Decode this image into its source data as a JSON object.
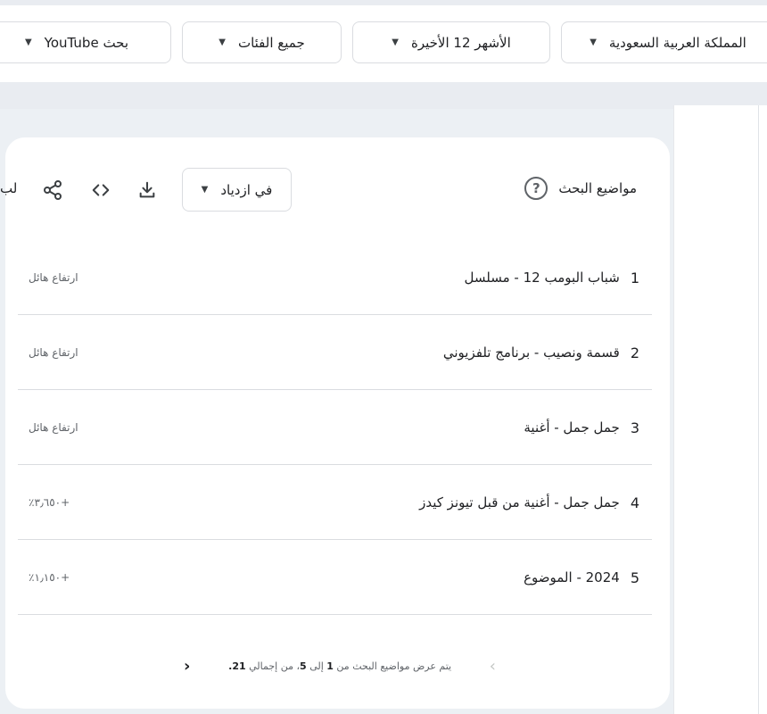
{
  "filters": {
    "region": "المملكة العربية السعودية",
    "period": "الأشهر 12 الأخيرة",
    "category": "جميع الفئات",
    "search_type": "بحث YouTube"
  },
  "card": {
    "title": "مواضيع البحث",
    "help_glyph": "?",
    "trend_select": "في ازدياد",
    "more_label": "لب"
  },
  "rows": [
    {
      "num": "1",
      "label": "شباب البومب 12 - مسلسل",
      "value": "ارتفاع هائل"
    },
    {
      "num": "2",
      "label": "قسمة ونصيب - برنامج تلفزيوني",
      "value": "ارتفاع هائل"
    },
    {
      "num": "3",
      "label": "جمل جمل - أغنية",
      "value": "ارتفاع هائل"
    },
    {
      "num": "4",
      "label": "جمل جمل - أغنية من قبل تيونز كيدز",
      "value": "+٣٫٦٥٠٪"
    },
    {
      "num": "5",
      "label": "2024 - الموضوع",
      "value": "+١٫١٥٠٪"
    }
  ],
  "pagination": {
    "prefix": "يتم عرض مواضيع البحث من ",
    "from": "1",
    "middle1": " إلى ",
    "to": "5",
    "middle2": "، من إجمالي ",
    "total": "21",
    "suffix": "."
  },
  "colors": {
    "background": "#e9ecf1",
    "card": "#ffffff",
    "border": "#dadce0",
    "muted_text": "#5f6368"
  }
}
